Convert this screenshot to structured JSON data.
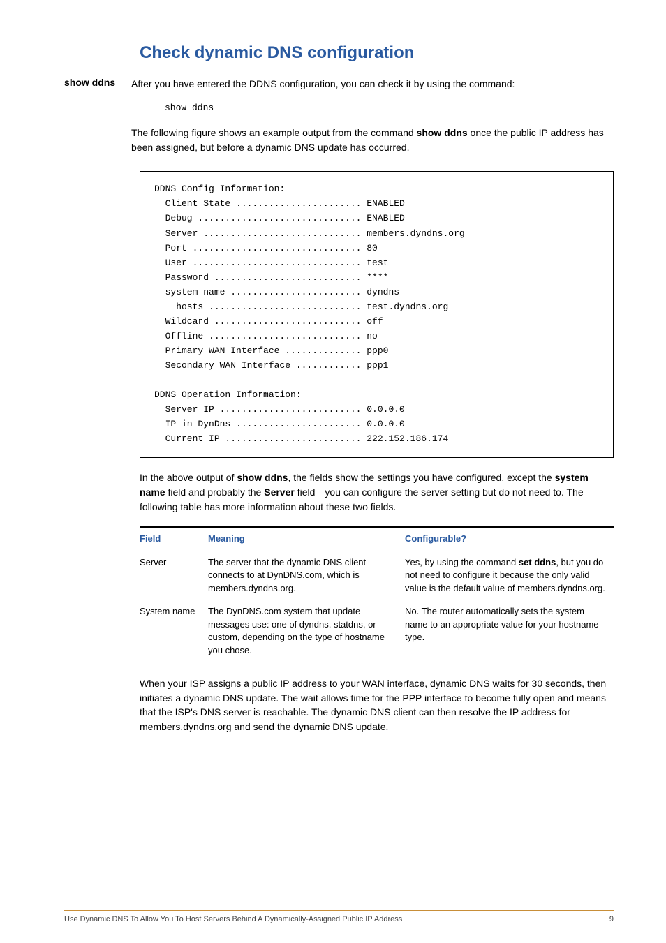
{
  "heading": "Check dynamic DNS configuration",
  "side_label": "show ddns",
  "intro": "After you have entered the DDNS configuration, you can check it by using the command:",
  "cmd": "show ddns",
  "intro2_a": "The following figure shows an example output from the command ",
  "intro2_bold": "show ddns",
  "intro2_b": " once the public IP address has been assigned, but before a dynamic DNS update has occurred.",
  "code_block": "DDNS Config Information:\n  Client State ....................... ENABLED\n  Debug .............................. ENABLED\n  Server ............................. members.dyndns.org\n  Port ............................... 80\n  User ............................... test\n  Password ........................... ****\n  system name ........................ dyndns\n    hosts ............................ test.dyndns.org\n  Wildcard ........................... off\n  Offline ............................ no\n  Primary WAN Interface .............. ppp0\n  Secondary WAN Interface ............ ppp1\n\nDDNS Operation Information:\n  Server IP .......................... 0.0.0.0\n  IP in DynDns ....................... 0.0.0.0\n  Current IP ......................... 222.152.186.174",
  "after1_a": "In the above output of ",
  "after1_bold1": "show ddns",
  "after1_b": ", the fields show the settings you have configured, except the ",
  "after1_bold2": "system name",
  "after1_c": " field and probably the ",
  "after1_bold3": "Server",
  "after1_d": " field—you can configure the server setting but do not need to. The following table has more information about these two fields.",
  "table": {
    "headers": {
      "field": "Field",
      "meaning": "Meaning",
      "conf": "Configurable?"
    },
    "rows": [
      {
        "field": "Server",
        "meaning": "The server that the dynamic DNS client connects to at DynDNS.com, which is members.dyndns.org.",
        "conf_a": "Yes, by using the command ",
        "conf_bold": "set ddns",
        "conf_b": ", but you do not need to configure it because the only valid value is the default value of members.dyndns.org."
      },
      {
        "field": "System name",
        "meaning": "The DynDNS.com system that update messages use: one of dyndns, statdns, or custom, depending on the type of hostname you chose.",
        "conf_a": "No. The router automatically sets the system name to an appropriate value for your hostname type.",
        "conf_bold": "",
        "conf_b": ""
      }
    ]
  },
  "after2": "When your ISP assigns a public IP address to your WAN interface, dynamic DNS waits for 30 seconds, then initiates a dynamic DNS update. The wait allows time for the PPP interface to become fully open and means that the ISP's DNS server is reachable. The dynamic DNS client can then resolve the IP address for members.dyndns.org and send the dynamic DNS update.",
  "footer_left": "Use Dynamic DNS To Allow You To Host Servers Behind A Dynamically-Assigned Public IP Address",
  "footer_right": "9"
}
